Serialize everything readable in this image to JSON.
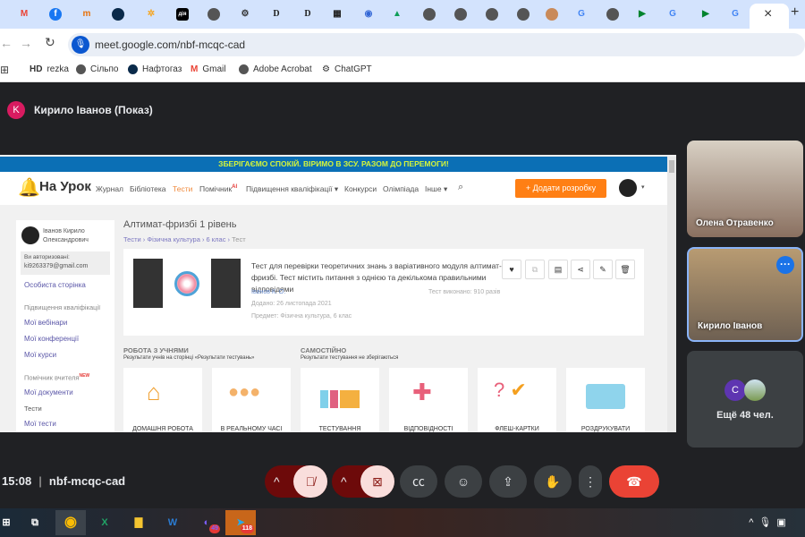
{
  "browser": {
    "url": "meet.google.com/nbf-mcqc-cad",
    "bookmarks": [
      {
        "label": "rezka",
        "prefix": "HD"
      },
      {
        "label": "Сільпо"
      },
      {
        "label": "Нафтогаз"
      },
      {
        "label": "Gmail"
      },
      {
        "label": "Adobe Acrobat"
      },
      {
        "label": "ChatGPT"
      }
    ],
    "new_tab": "+",
    "close_tab": "×"
  },
  "meet": {
    "presenter_initial": "K",
    "presenter_label": "Кирило Іванов (Показ)",
    "time": "15:08",
    "meeting_code": "nbf-mcqc-cad",
    "participants": [
      {
        "name": "Олена Отравенко"
      },
      {
        "name": "Кирило Іванов"
      }
    ],
    "more_people": "Ещё 48 чел.",
    "more_initial": "C",
    "accent": "#1a73e8",
    "end_color": "#ea4335"
  },
  "shared": {
    "banner": "ЗБЕРІГАЄМО СПОКІЙ. ВІРИМО В ЗСУ. РАЗОМ ДО ПЕРЕМОГИ!",
    "logo": "На Урок",
    "nav": [
      "Журнал",
      "Бібліотека",
      "Тести",
      "Помічник",
      "Підвищення кваліфікації ▾",
      "Конкурси",
      "Олімпіада",
      "Інше ▾"
    ],
    "nav_badge": "AI",
    "add_button": "+ Додати розробку",
    "user_name": "Іванов Кирило Олександрович",
    "auth_label": "Ви авторизовані:",
    "email": "ki9263379@gmail.com",
    "side_links": [
      "Особиста сторінка"
    ],
    "side_group1": "Підвищення кваліфікації",
    "side_group1_links": [
      "Мої вебінари",
      "Мої конференції",
      "Мої курси"
    ],
    "side_group2": "Помічник вчителя",
    "side_group2_badge": "NEW",
    "side_group2_links": [
      "Мої документи"
    ],
    "side_group3": "Тести",
    "side_group3_links": [
      "Мої тести"
    ],
    "title": "Алтимат-фризбі 1 рівень",
    "breadcrumb": [
      "Тести",
      "Фізична культура",
      "6 клас",
      "Тест"
    ],
    "test_desc": "Тест для перевірки теоретичних знань з варіативного модуля алтимат-фризбі. Тест містить питання з однією та декількома правильними відповідями",
    "author": "Іванов К. О.",
    "added": "Додано: 26 листопада 2021",
    "subject": "Предмет: Фізична культура, 6 клас",
    "done": "Тест виконано: 910 разів",
    "section1_title": "РОБОТА З УЧНЯМИ",
    "section1_sub": "Результати учнів на сторінці «Результати тестувань»",
    "section2_title": "САМОСТІЙНО",
    "section2_sub": "Результати тестування не зберігаються",
    "tiles": [
      "ДОМАШНЯ РОБОТА",
      "В РЕАЛЬНОМУ ЧАСІ",
      "ТЕСТУВАННЯ",
      "ВІДПОВІДНОСТІ",
      "ФЛЕШ-КАРТКИ",
      "РОЗДРУКУВАТИ"
    ]
  },
  "taskbar": {
    "viber_badge": "49",
    "telegram_badge": "118"
  }
}
